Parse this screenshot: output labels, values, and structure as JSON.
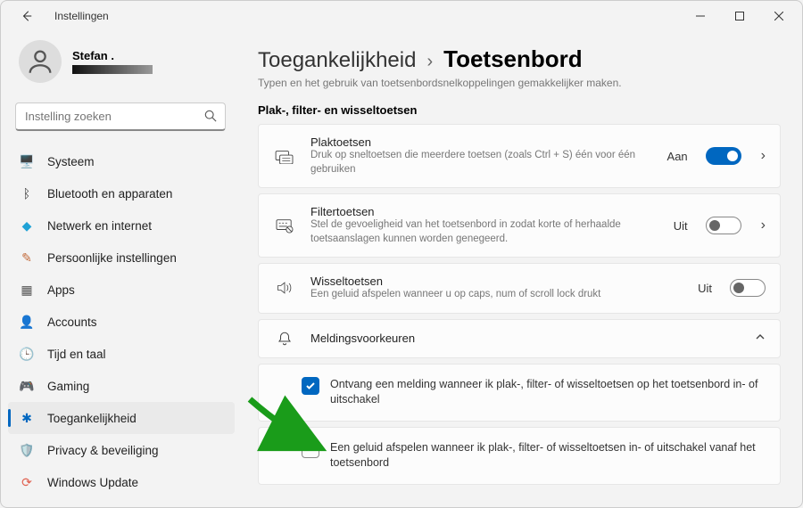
{
  "window_title": "Instellingen",
  "user": {
    "name": "Stefan ."
  },
  "search": {
    "placeholder": "Instelling zoeken"
  },
  "nav": [
    {
      "icon": "🖥️",
      "label": "Systeem",
      "color": "#0078d4"
    },
    {
      "icon": "ᛒ",
      "label": "Bluetooth en apparaten",
      "color": "#333"
    },
    {
      "icon": "◆",
      "label": "Netwerk en internet",
      "color": "#1fa2d6"
    },
    {
      "icon": "✎",
      "label": "Persoonlijke instellingen",
      "color": "#c26a3a"
    },
    {
      "icon": "▦",
      "label": "Apps",
      "color": "#555"
    },
    {
      "icon": "👤",
      "label": "Accounts",
      "color": "#3aa06f"
    },
    {
      "icon": "🕒",
      "label": "Tijd en taal",
      "color": "#e0604f"
    },
    {
      "icon": "🎮",
      "label": "Gaming",
      "color": "#555"
    },
    {
      "icon": "✱",
      "label": "Toegankelijkheid",
      "color": "#0067c0",
      "active": true
    },
    {
      "icon": "🛡️",
      "label": "Privacy & beveiliging",
      "color": "#555"
    },
    {
      "icon": "⟳",
      "label": "Windows Update",
      "color": "#e0604f"
    }
  ],
  "breadcrumb": {
    "parent": "Toegankelijkheid",
    "current": "Toetsenbord"
  },
  "intro": "Typen en het gebruik van toetsenbordsnelkoppelingen gemakkelijker maken.",
  "section": "Plak-, filter- en wisseltoetsen",
  "rows": {
    "sticky": {
      "title": "Plaktoetsen",
      "sub": "Druk op sneltoetsen die meerdere toetsen (zoals Ctrl + S) één voor één gebruiken",
      "state": "Aan"
    },
    "filter": {
      "title": "Filtertoetsen",
      "sub": "Stel de gevoeligheid van het toetsenbord in zodat korte of herhaalde toetsaanslagen kunnen worden genegeerd.",
      "state": "Uit"
    },
    "toggle": {
      "title": "Wisseltoetsen",
      "sub": "Een geluid afspelen wanneer u op caps, num of scroll lock drukt",
      "state": "Uit"
    },
    "prefs": {
      "title": "Meldingsvoorkeuren"
    }
  },
  "checks": {
    "notify": "Ontvang een melding wanneer ik plak-, filter- of wisseltoetsen op het toetsenbord in- of uitschakel",
    "sound": "Een geluid afspelen wanneer ik plak-, filter- of wisseltoetsen in- of uitschakel vanaf het toetsenbord"
  }
}
